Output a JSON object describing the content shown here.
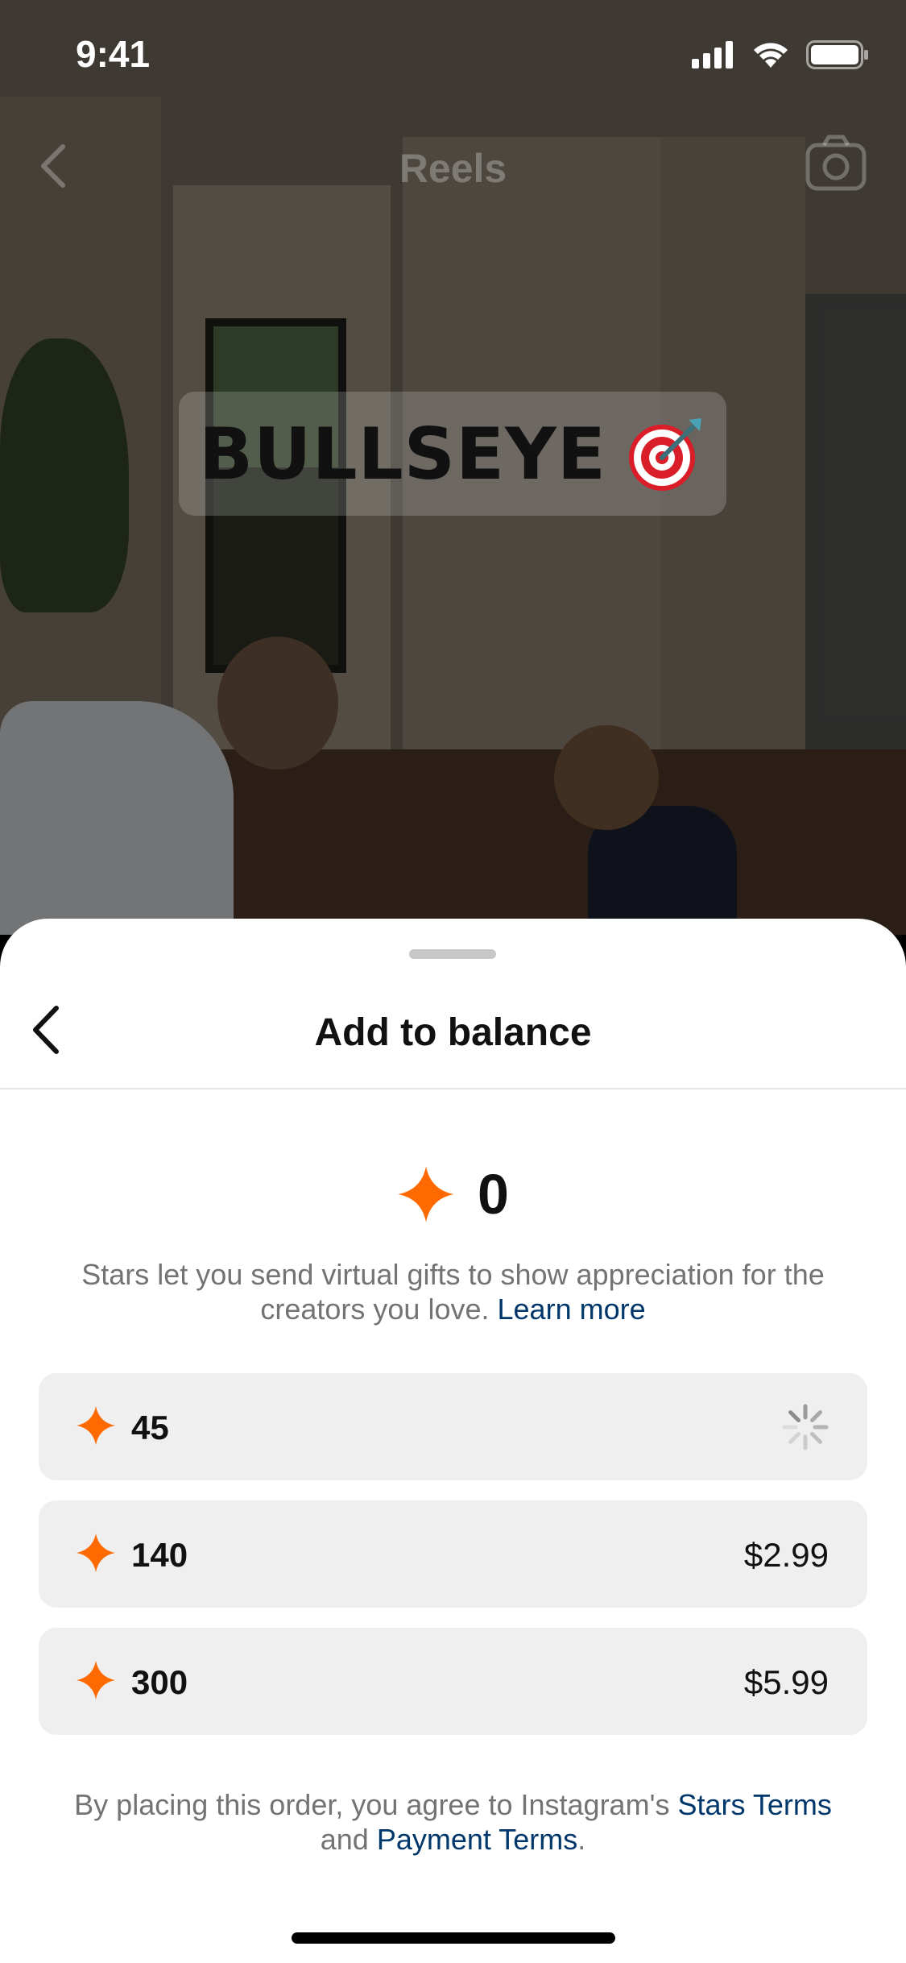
{
  "status_bar": {
    "time": "9:41"
  },
  "header": {
    "title": "Reels"
  },
  "video": {
    "sticker_text": "BULLSEYE",
    "sticker_icon": "target-dart-icon"
  },
  "sheet": {
    "title": "Add to balance",
    "balance": "0",
    "description": "Stars let you send virtual gifts to show appreciation for the creators you love.",
    "learn_more": "Learn more",
    "options": [
      {
        "amount": "45",
        "price": "",
        "loading": true
      },
      {
        "amount": "140",
        "price": "$2.99"
      },
      {
        "amount": "300",
        "price": "$5.99"
      }
    ],
    "terms_prefix": "By placing this order, you agree to Instagram's",
    "stars_terms": "Stars Terms",
    "terms_and": "and",
    "payment_terms": "Payment Terms",
    "terms_suffix": "."
  },
  "colors": {
    "star": "#ff6a00",
    "link": "#00376b",
    "muted_text": "#737373"
  }
}
